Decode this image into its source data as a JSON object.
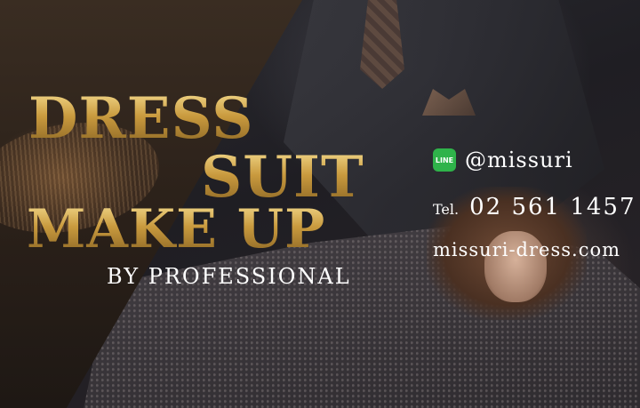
{
  "headline": {
    "line1": "DRESS",
    "line2": "SUIT",
    "line3": "MAKE UP"
  },
  "subtitle": "BY PROFESSIONAL",
  "contact": {
    "line_icon": "line-app-icon",
    "line_icon_text": "LINE",
    "line_handle": "@missuri",
    "tel_label": "Tel.",
    "tel_number": "02 561 1457",
    "website": "missuri-dress.com"
  },
  "colors": {
    "gold": "#c99a3e",
    "line_green": "#2fb34a",
    "text_white": "#ffffff"
  }
}
